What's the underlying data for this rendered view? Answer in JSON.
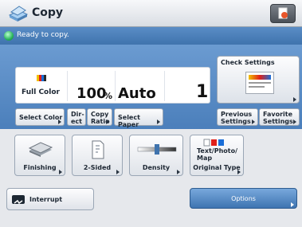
{
  "title": "Copy",
  "status": "Ready to copy.",
  "info": {
    "color": "Full Color",
    "ratio": "100",
    "ratio_unit": "%",
    "paper": "Auto",
    "quantity": "1"
  },
  "buttons": {
    "select_color": "Select Color",
    "direct_1": "Dir-",
    "direct_2": "ect",
    "copy_ratio_1": "Copy",
    "copy_ratio_2": "Ratio",
    "select_paper": "Select Paper",
    "check_settings": "Check Settings",
    "previous_1": "Previous",
    "previous_2": "Settings",
    "favorite_1": "Favorite",
    "favorite_2": "Settings",
    "finishing": "Finishing",
    "two_sided": "2-Sided",
    "density": "Density",
    "text_photo_1": "Text/Photo/",
    "text_photo_2": "Map",
    "original_type": "Original Type",
    "interrupt": "Interrupt",
    "options": "Options"
  },
  "icons": [
    "copy-icon",
    "sheet-settings-icon",
    "ready-icon",
    "color-icon",
    "check-settings-icon",
    "finishing-icon",
    "two-sided-icon",
    "density-icon",
    "original-type-icon",
    "interrupt-icon"
  ],
  "colors": {
    "status_blue": "#3f73ad",
    "panel_blue": "#5a8dc6",
    "ready_green": "#28b35a"
  }
}
